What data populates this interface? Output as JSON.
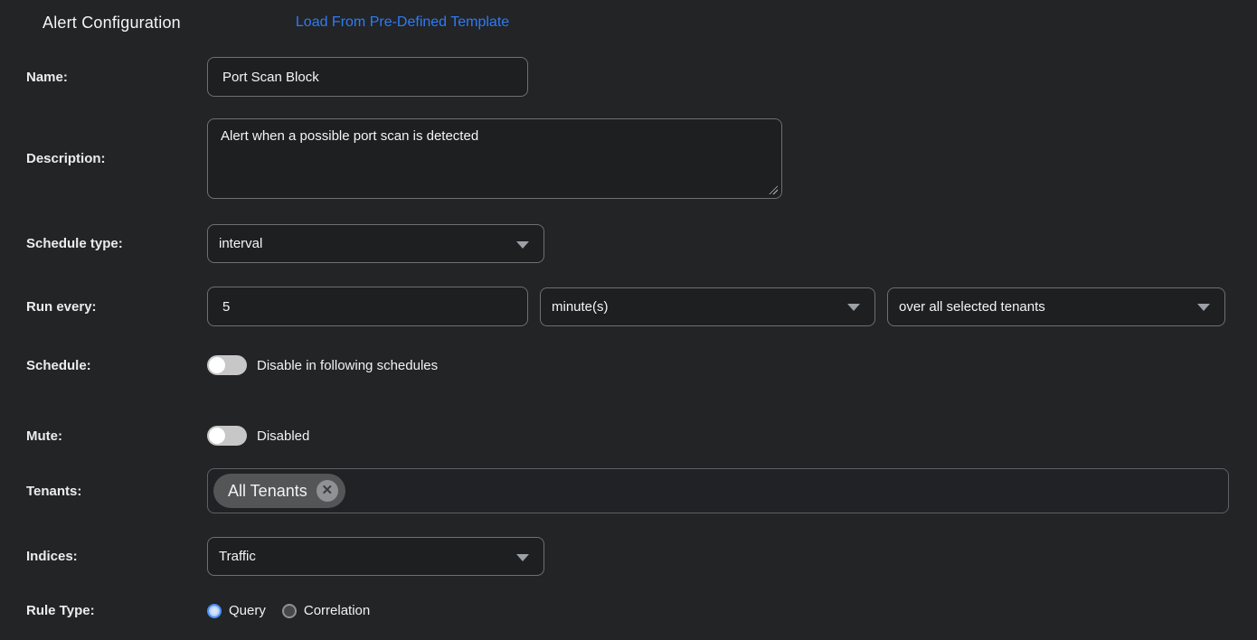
{
  "header": {
    "title": "Alert Configuration",
    "template_link": "Load From Pre-Defined Template"
  },
  "fields": {
    "name": {
      "label": "Name:",
      "value": "Port Scan Block"
    },
    "description": {
      "label": "Description:",
      "value": "Alert when a possible port scan is detected"
    },
    "schedule_type": {
      "label": "Schedule type:",
      "value": "interval"
    },
    "run_every": {
      "label": "Run every:",
      "value": "5",
      "unit": "minute(s)",
      "scope": "over all selected tenants"
    },
    "schedule": {
      "label": "Schedule:",
      "toggle_on": false,
      "toggle_label": "Disable in following schedules"
    },
    "mute": {
      "label": "Mute:",
      "toggle_on": false,
      "toggle_label": "Disabled"
    },
    "tenants": {
      "label": "Tenants:",
      "chips": [
        {
          "text": "All Tenants",
          "remove_icon": "x-circle-icon"
        }
      ]
    },
    "indices": {
      "label": "Indices:",
      "value": "Traffic"
    },
    "rule_type": {
      "label": "Rule Type:",
      "options": [
        {
          "label": "Query",
          "selected": true
        },
        {
          "label": "Correlation",
          "selected": false
        }
      ]
    }
  },
  "colors": {
    "background": "#222426",
    "input_background": "#1d1f21",
    "input_border": "#6d7174",
    "link_blue": "#2f7bf6",
    "toggle_track": "#c7c7c7",
    "chip_background": "#545557",
    "radio_selected_blue": "#4c8bf5"
  }
}
